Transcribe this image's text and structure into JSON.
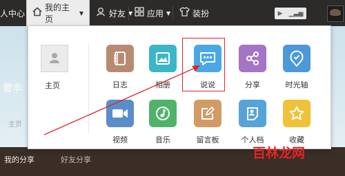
{
  "navbar": {
    "personal_center": "人中心",
    "my_home": "我的主页",
    "friends": "好友",
    "apps": "应用",
    "dress_up": "装扮"
  },
  "background": {
    "title_fragment": "雪丰",
    "home_link_fragment": "主页",
    "tabs": [
      "我的分享",
      "好友分享"
    ]
  },
  "dropdown": {
    "home_label": "主页",
    "apps": [
      {
        "label": "日志",
        "color": "#b98a72",
        "icon": "diary-icon"
      },
      {
        "label": "相册",
        "color": "#3cb5c9",
        "icon": "photo-album-icon"
      },
      {
        "label": "说说",
        "color": "#4aa8e6",
        "icon": "chat-bubble-icon"
      },
      {
        "label": "分享",
        "color": "#a574c6",
        "icon": "share-icon"
      },
      {
        "label": "时光轴",
        "color": "#4d98d8",
        "icon": "timeline-icon"
      },
      {
        "label": "视频",
        "color": "#5a8ec9",
        "icon": "video-icon"
      },
      {
        "label": "音乐",
        "color": "#4fb36a",
        "icon": "music-icon"
      },
      {
        "label": "留言板",
        "color": "#d49a63",
        "icon": "message-board-icon"
      },
      {
        "label": "个人档",
        "color": "#55a3d8",
        "icon": "profile-icon"
      },
      {
        "label": "收藏",
        "color": "#f0c23a",
        "icon": "favorites-icon"
      }
    ]
  },
  "watermark": {
    "text": "百林龙网",
    "domain": "www.cnfengyan.com"
  }
}
